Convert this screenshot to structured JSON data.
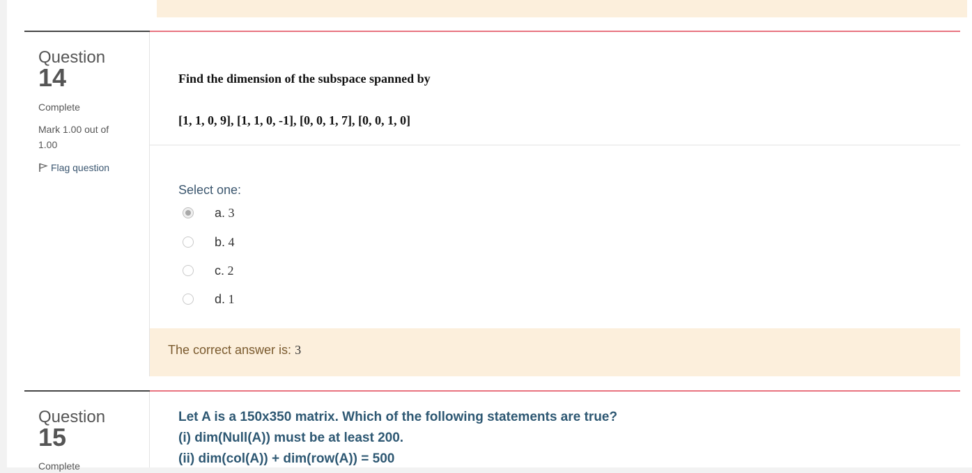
{
  "q14": {
    "label": "Question",
    "number": "14",
    "state": "Complete",
    "mark": "Mark 1.00 out of 1.00",
    "flag": "Flag question",
    "text_line1": "Find the dimension of the subspace spanned by",
    "text_line2": "[1, 1, 0, 9], [1, 1, 0, -1], [0, 0, 1, 7], [0, 0, 1, 0]",
    "prompt": "Select one:",
    "options": [
      {
        "letter": "a.",
        "value": "3",
        "checked": true
      },
      {
        "letter": "b.",
        "value": "4",
        "checked": false
      },
      {
        "letter": "c.",
        "value": "2",
        "checked": false
      },
      {
        "letter": "d.",
        "value": "1",
        "checked": false
      }
    ],
    "feedback_label": "The correct answer is: ",
    "feedback_answer": "3"
  },
  "q15": {
    "label": "Question",
    "number": "15",
    "state": "Complete",
    "lines": [
      "Let A is a 150x350 matrix. Which of the following statements are true?",
      "(i) dim(Null(A)) must be at least 200.",
      "(ii) dim(col(A)) + dim(row(A)) = 500"
    ]
  },
  "colors": {
    "accent_rule": "#e8737f",
    "feedback_bg": "#fcefdc",
    "question_text": "#2e5873"
  }
}
